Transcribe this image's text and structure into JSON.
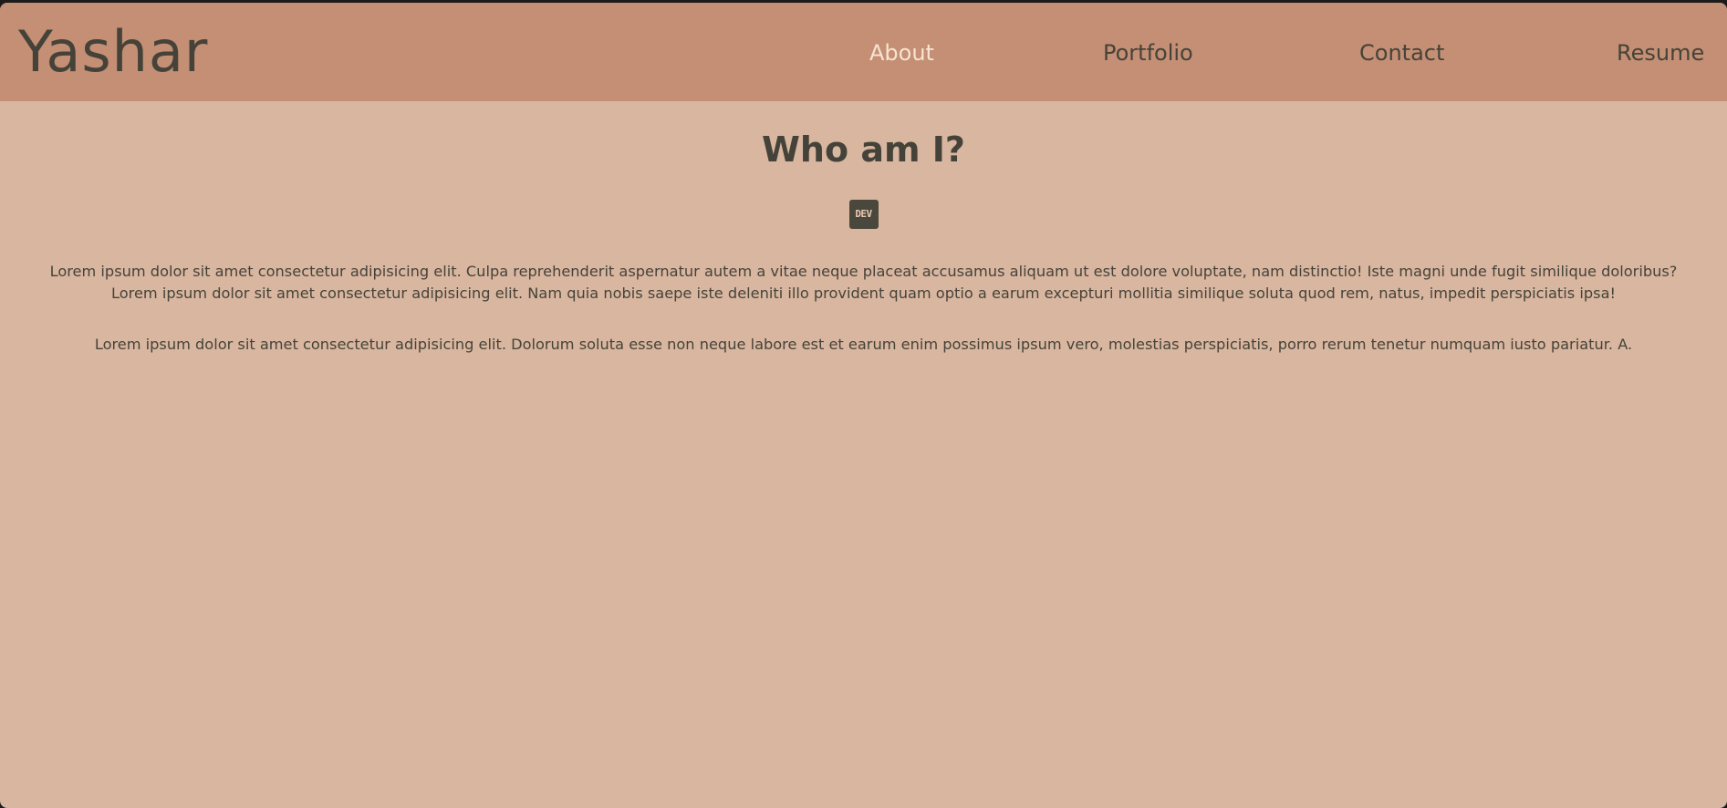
{
  "header": {
    "brand": "Yashar",
    "nav": [
      {
        "label": "About",
        "active": true
      },
      {
        "label": "Portfolio",
        "active": false
      },
      {
        "label": "Contact",
        "active": false
      },
      {
        "label": "Resume",
        "active": false
      }
    ]
  },
  "main": {
    "title": "Who am I?",
    "dev_badge": "DEV",
    "paragraphs": [
      "Lorem ipsum dolor sit amet consectetur adipisicing elit. Culpa reprehenderit aspernatur autem a vitae neque placeat accusamus aliquam ut est dolore voluptate, nam distinctio! Iste magni unde fugit similique doloribus? Lorem ipsum dolor sit amet consectetur adipisicing elit. Nam quia nobis saepe iste deleniti illo provident quam optio a earum excepturi mollitia similique soluta quod rem, natus, impedit perspiciatis ipsa!",
      "Lorem ipsum dolor sit amet consectetur adipisicing elit. Dolorum soluta esse non neque labore est et earum enim possimus ipsum vero, molestias perspiciatis, porro rerum tenetur numquam iusto pariatur. A."
    ]
  },
  "colors": {
    "header_bg": "#c48f74",
    "page_bg": "#d9b6a0",
    "text": "#454339",
    "active_link": "#f8e3d2",
    "badge_bg": "#4a473c"
  },
  "icons": {
    "dev_badge": "dev-to-icon"
  }
}
